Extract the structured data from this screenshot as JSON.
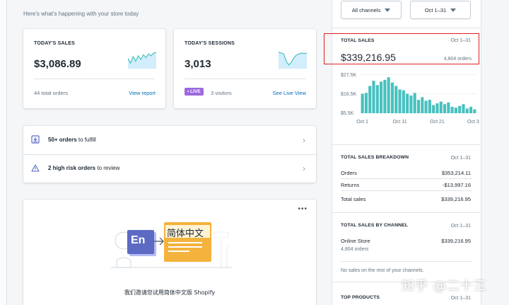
{
  "header": {
    "subtitle": "Here's what's happening with your store today"
  },
  "today_sales": {
    "label": "TODAY'S SALES",
    "value": "$3,086.89",
    "orders": "44 total orders",
    "link": "View report",
    "sparkline": [
      0.55,
      0.3,
      0.65,
      0.4,
      0.7,
      0.5,
      0.75,
      0.6,
      0.8,
      0.7,
      0.85,
      0.88
    ]
  },
  "today_sessions": {
    "label": "TODAY'S SESSIONS",
    "value": "3,013",
    "live_badge": "• LIVE",
    "visitors": "3 visitors",
    "link": "See Live View",
    "sparkline": [
      0.9,
      0.85,
      0.8,
      0.4,
      0.2,
      0.35,
      0.6,
      0.75,
      0.8,
      0.85,
      0.82,
      0.85
    ]
  },
  "tasks": [
    {
      "bold": "50+ orders",
      "rest": " to fulfill",
      "icon": "download-box-icon"
    },
    {
      "bold": "2 high risk orders",
      "rest": " to review",
      "icon": "warning-icon"
    }
  ],
  "promo": {
    "menu": "•••",
    "en_label": "En",
    "cn_label": "简体中文",
    "caption": "我们邀请您试用简体中文版 Shopify"
  },
  "filters": {
    "channels": "All channels",
    "date": "Oct 1–31"
  },
  "total_sales": {
    "title": "TOTAL SALES",
    "date": "Oct 1–31",
    "value": "$339,216.95",
    "orders": "4,804 orders",
    "chart_data": {
      "type": "bar",
      "title": "TOTAL SALES",
      "yticks": [
        "$27.5K",
        "$16.5K",
        "$5.5K"
      ],
      "xticks": [
        "Oct 1",
        "Oct 11",
        "Oct 21",
        "Oct 31"
      ],
      "ylim": [
        5500,
        27500
      ],
      "values": [
        16500,
        17000,
        21000,
        24000,
        21500,
        23500,
        24500,
        26000,
        23000,
        21000,
        19000,
        18500,
        16500,
        15500,
        17000,
        13000,
        14500,
        12500,
        13000,
        10000,
        11000,
        12000,
        10500,
        11500,
        9000,
        8500,
        9500,
        10500,
        8000,
        9000,
        7500
      ],
      "color": "#47c1bf"
    }
  },
  "breakdown": {
    "title": "TOTAL SALES BREAKDOWN",
    "date": "Oct 1–31",
    "rows": [
      {
        "label": "Orders",
        "value": "$353,214.11"
      },
      {
        "label": "Returns",
        "value": "-$13,997.16"
      },
      {
        "label": "Total sales",
        "value": "$339,216.95"
      }
    ]
  },
  "by_channel": {
    "title": "TOTAL SALES BY CHANNEL",
    "date": "Oct 1–31",
    "channel": "Online Store",
    "channel_value": "$339,216.95",
    "channel_orders": "4,804 orders",
    "note": "No sales on the rest of your channels."
  },
  "top_products": {
    "title": "TOP PRODUCTS",
    "date": "Oct 1–31"
  },
  "watermark": "知乎 @二十三"
}
